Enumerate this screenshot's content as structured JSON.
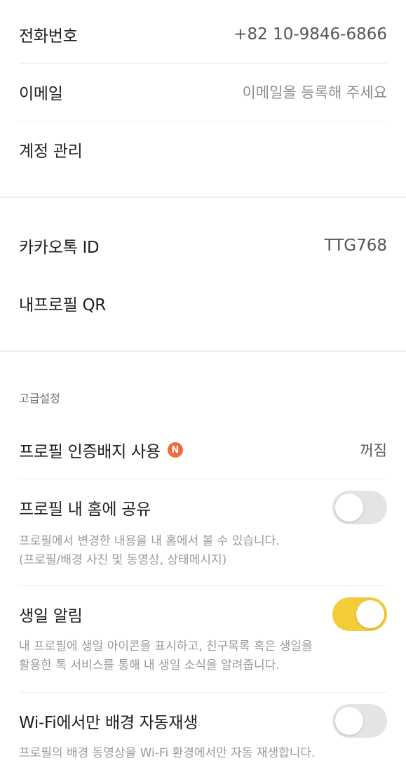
{
  "account": {
    "phone_label": "전화번호",
    "phone_value": "+82 10-9846-6866",
    "email_label": "이메일",
    "email_placeholder": "이메일을 등록해 주세요",
    "account_manage_label": "계정 관리"
  },
  "kakao": {
    "id_label": "카카오톡 ID",
    "id_value": "TTG768",
    "qr_label": "내프로필 QR"
  },
  "advanced": {
    "section_title": "고급설정",
    "badge_label": "프로필 인증배지 사용",
    "new_badge": "N",
    "badge_status": "꺼짐",
    "share_home_label": "프로필 내 홈에 공유",
    "share_home_state": "off",
    "share_home_desc_1": "프로필에서 변경한 내용을 내 홈에서 볼 수 있습니다.",
    "share_home_desc_2": "(프로필/배경 사진 및 동영상, 상태메시지)",
    "birthday_label": "생일 알림",
    "birthday_state": "on",
    "birthday_desc_1": "내 프로필에 생일 아이콘을 표시하고, 친구목록 혹은 생일을",
    "birthday_desc_2": "활용한 톡 서비스를 통해 내 생일 소식을 알려줍니다.",
    "wifi_label": "Wi-Fi에서만 배경 자동재생",
    "wifi_state": "off",
    "wifi_desc_1": "프로필의 배경 동영상을 Wi-Fi 환경에서만 자동 재생합니다."
  },
  "colors": {
    "toggle_on": "#f3cc3a",
    "toggle_off": "#e4e4e4",
    "new_badge": "#f26b3a"
  }
}
